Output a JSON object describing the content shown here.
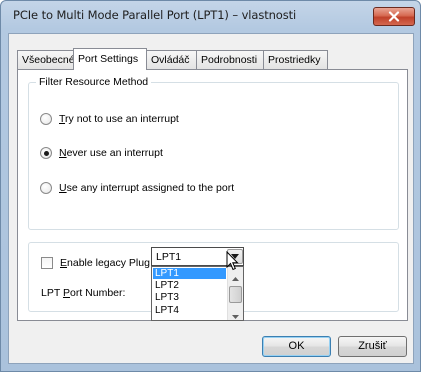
{
  "window": {
    "title": "PCIe to Multi Mode Parallel Port (LPT1) – vlastnosti",
    "close_label": "close"
  },
  "tabs": [
    {
      "label": "Všeobecné",
      "active": false
    },
    {
      "label": "Port Settings",
      "active": true
    },
    {
      "label": "Ovládáč",
      "active": false
    },
    {
      "label": "Podrobnosti",
      "active": false
    },
    {
      "label": "Prostriedky",
      "active": false
    }
  ],
  "filter_group": {
    "legend": "Filter Resource Method",
    "options": [
      {
        "mnemonic": "T",
        "rest": "ry not to use an interrupt",
        "checked": false
      },
      {
        "mnemonic": "N",
        "rest": "ever use an interrupt",
        "checked": true
      },
      {
        "mnemonic": "U",
        "rest": "se any interrupt assigned to the port",
        "checked": false
      }
    ]
  },
  "legacy": {
    "checkbox_mnemonic": "E",
    "checkbox_rest": "nable legacy Plug and Play detection",
    "checked": false
  },
  "lpt": {
    "label_pre": "LPT ",
    "label_mnemonic": "P",
    "label_post": "ort Number:",
    "selected": "LPT1",
    "options": [
      "LPT1",
      "LPT2",
      "LPT3",
      "LPT4"
    ]
  },
  "buttons": {
    "ok": "OK",
    "cancel": "Zrušiť"
  }
}
